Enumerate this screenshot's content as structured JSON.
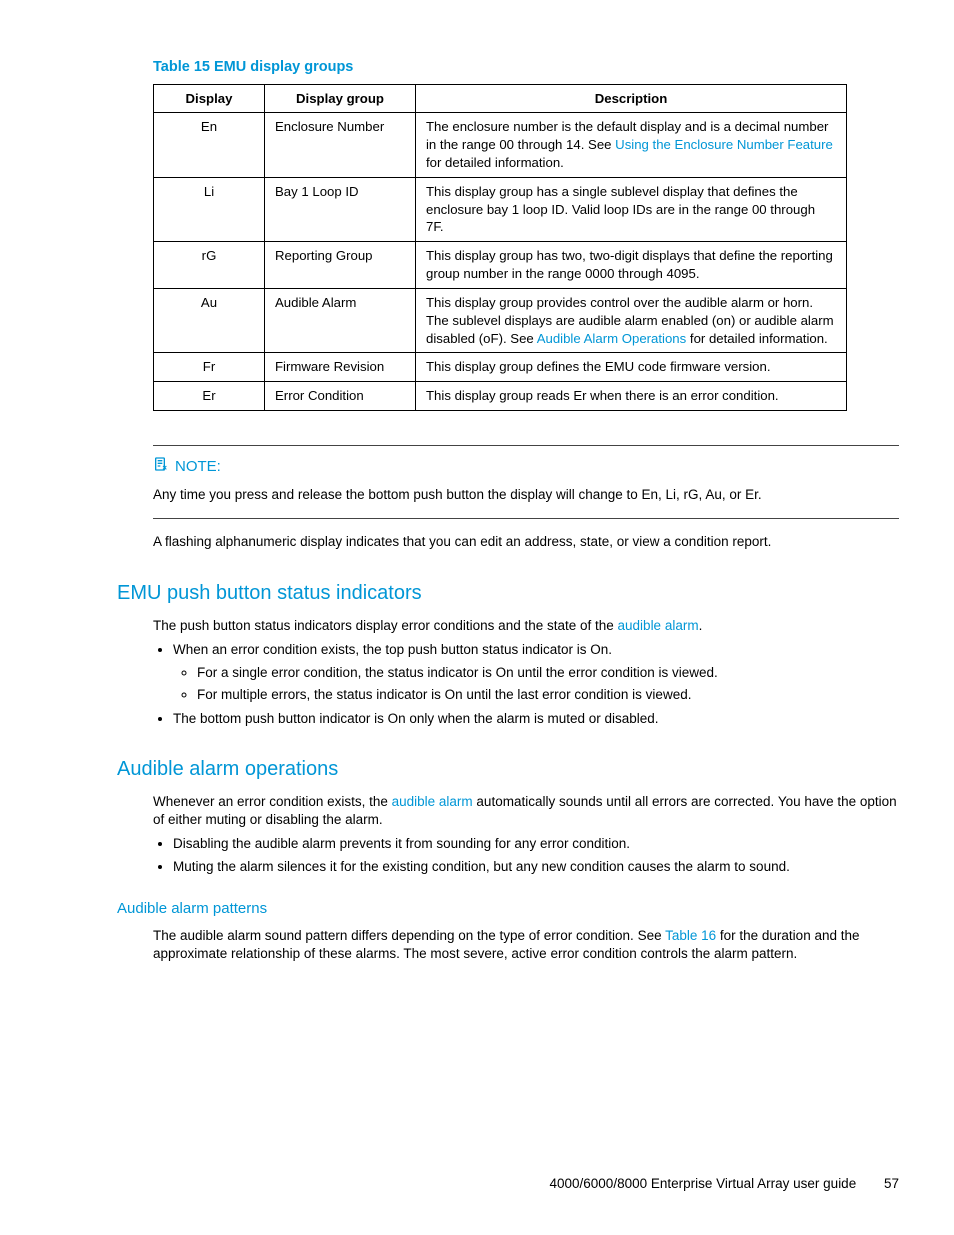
{
  "tableTitle": "Table 15 EMU display groups",
  "tableHeaders": {
    "c1": "Display",
    "c2": "Display group",
    "c3": "Description"
  },
  "rows": [
    {
      "display": "En",
      "group": "Enclosure Number",
      "desc_a": "The enclosure number is the default display and is a decimal number in the range 00 through 14. See ",
      "desc_link": "Using the Enclosure Number Feature",
      "desc_b": " for detailed information."
    },
    {
      "display": "Li",
      "group": "Bay 1 Loop ID",
      "desc_a": "This display group has a single sublevel display that defines the enclosure bay 1 loop ID. Valid loop IDs are in the range 00 through 7F.",
      "desc_link": "",
      "desc_b": ""
    },
    {
      "display": "rG",
      "group": "Reporting Group",
      "desc_a": "This display group has two, two-digit displays that define the reporting group number in the range 0000 through 4095.",
      "desc_link": "",
      "desc_b": ""
    },
    {
      "display": "Au",
      "group": "Audible Alarm",
      "desc_a": "This display group provides control over the audible alarm or horn. The sublevel displays are audible alarm enabled (on) or audible alarm disabled (oF). See ",
      "desc_link": "Audible Alarm Operations",
      "desc_b": " for detailed information."
    },
    {
      "display": "Fr",
      "group": "Firmware Revision",
      "desc_a": "This display group defines the EMU code firmware version.",
      "desc_link": "",
      "desc_b": ""
    },
    {
      "display": "Er",
      "group": "Error Condition",
      "desc_a": "This display group reads Er when there is an error condition.",
      "desc_link": "",
      "desc_b": ""
    }
  ],
  "note": {
    "label": "NOTE:",
    "body": "Any time you press and release the bottom push button the display will change to En, Li, rG, Au, or Er."
  },
  "afterNote": "A flashing alphanumeric display indicates that you can edit an address, state, or view a condition report.",
  "section1": {
    "title": "EMU push button status indicators",
    "intro_a": "The push button status indicators display error conditions and the state of the ",
    "intro_link": "audible alarm",
    "intro_b": ".",
    "b1": "When an error condition exists, the top push button status indicator is On.",
    "b1a": "For a single error condition, the status indicator is On until the error condition is viewed.",
    "b1b": "For multiple errors, the status indicator is On until the last error condition is viewed.",
    "b2": "The bottom push button indicator is On only when the alarm is muted or disabled."
  },
  "section2": {
    "title": "Audible alarm operations",
    "intro_a": "Whenever an error condition exists, the ",
    "intro_link": "audible alarm",
    "intro_b": " automatically sounds until all errors are corrected. You have the option of either muting or disabling the alarm.",
    "b1": "Disabling the audible alarm prevents it from sounding for any error condition.",
    "b2": "Muting the alarm silences it for the existing condition, but any new condition causes the alarm to sound."
  },
  "section3": {
    "title": "Audible alarm patterns",
    "body_a": "The audible alarm sound pattern differs depending on the type of error condition. See ",
    "body_link": "Table 16",
    "body_b": " for the duration and the approximate relationship of these alarms. The most severe, active error condition controls the alarm pattern."
  },
  "footer": {
    "text": "4000/6000/8000 Enterprise Virtual Array user guide",
    "page": "57"
  }
}
